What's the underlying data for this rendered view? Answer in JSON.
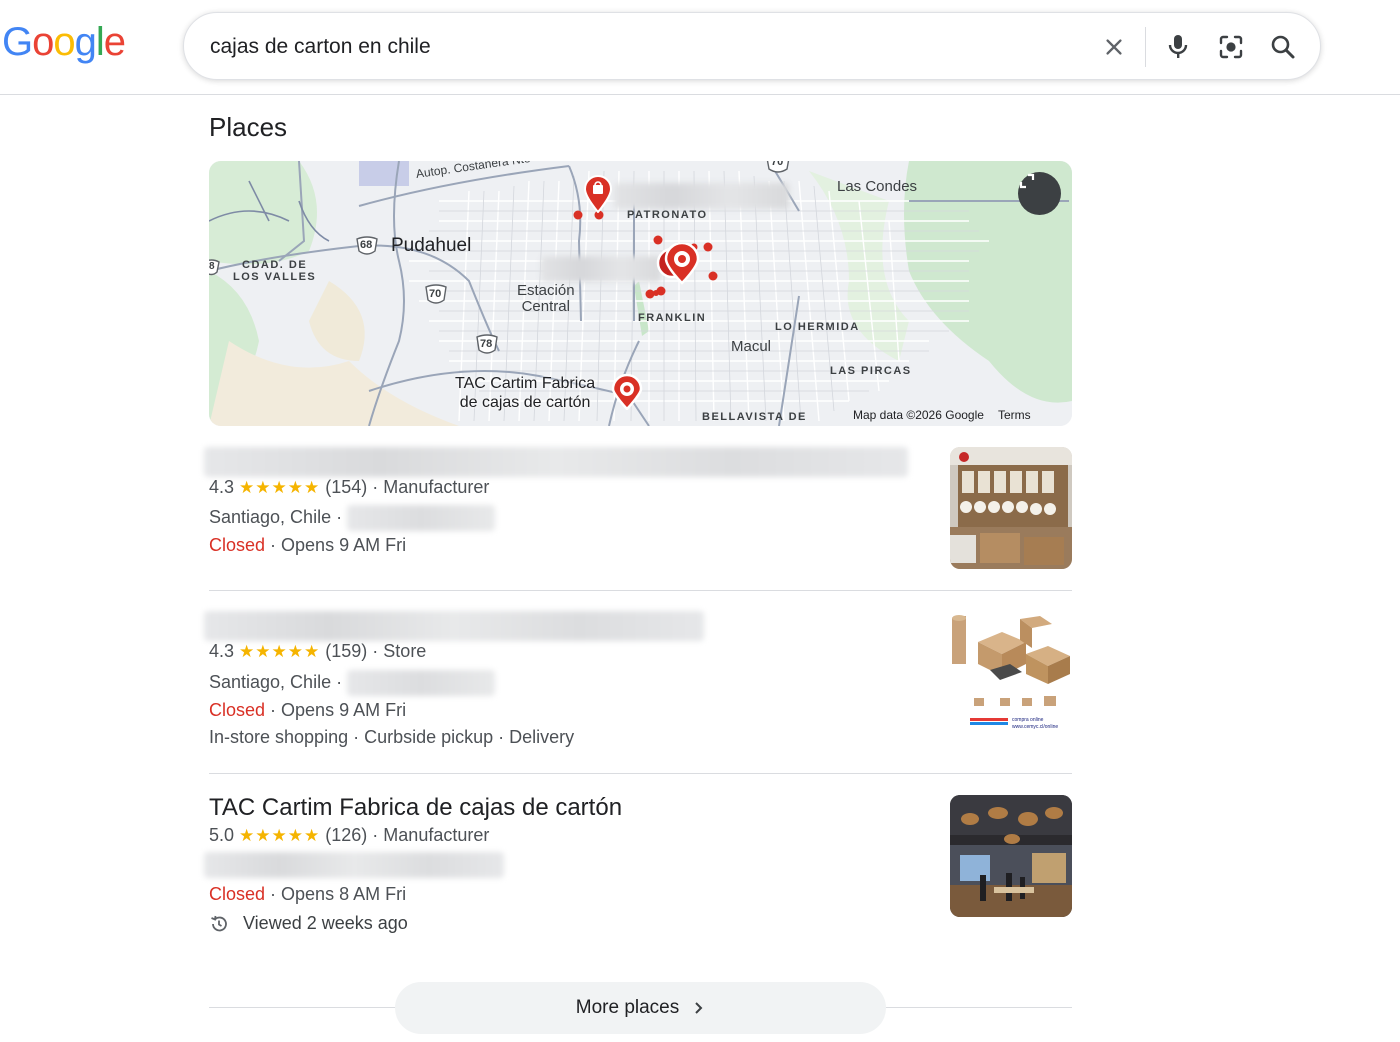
{
  "logo": {
    "letters": [
      "G",
      "o",
      "o",
      "g",
      "l",
      "e"
    ],
    "colors": [
      "#4285f4",
      "#ea4335",
      "#fbbc05",
      "#4285f4",
      "#34a853",
      "#ea4335"
    ]
  },
  "search": {
    "value": "cajas de carton en chile",
    "clear_icon": "close-icon",
    "voice_icon": "mic-icon",
    "lens_icon": "camera-lens-icon",
    "search_icon": "search-icon"
  },
  "places": {
    "title": "Places",
    "map": {
      "labels": {
        "costanera": "Autop. Costanera Nte",
        "pudahuel": "Pudahuel",
        "cdad": "CDAD. DE\nLOS VALLES",
        "estacion": "Estación\nCentral",
        "patronato": "PATRONATO",
        "franklin": "FRANKLIN",
        "macul": "Macul",
        "lo_hermida": "LO HERMIDA",
        "las_condes": "Las Condes",
        "las_pircas": "LAS PIRCAS",
        "bellavista": "BELLAVISTA DE",
        "tac": "TAC Cartim Fabrica\nde cajas de cartón",
        "route_68": "68",
        "route_70a": "70",
        "route_70b": "70",
        "route_78": "78",
        "route_8": "8"
      },
      "footer_data": "Map data ©2026 Google",
      "footer_terms": "Terms",
      "expand_icon": "expand-icon"
    },
    "results": [
      {
        "title": "",
        "rating": "4.3",
        "stars": "★★★★★",
        "reviews": "(154)",
        "category": "Manufacturer",
        "location": "Santiago, Chile",
        "status": "Closed",
        "hours": "Opens 9 AM Fri",
        "thumb": "warehouse-shelves-photo"
      },
      {
        "title": "",
        "rating": "4.3",
        "stars": "★★★★★",
        "reviews": "(159)",
        "category": "Store",
        "location": "Santiago, Chile",
        "status": "Closed",
        "hours": "Opens 9 AM Fri",
        "services": "In-store shopping · Curbside pickup · Delivery",
        "thumb": "cardboard-boxes-photo",
        "thumb_text1": "compra online",
        "thumb_text2": "www.cemyc.cl/online"
      },
      {
        "title": "TAC Cartim Fabrica de cajas de cartón",
        "rating": "5.0",
        "stars": "★★★★★",
        "reviews": "(126)",
        "category": "Manufacturer",
        "status": "Closed",
        "hours": "Opens 8 AM Fri",
        "viewed": "Viewed 2 weeks ago",
        "history_icon": "history-icon",
        "thumb": "store-interior-photo"
      }
    ],
    "more_label": "More places",
    "more_icon": "chevron-right-icon"
  }
}
